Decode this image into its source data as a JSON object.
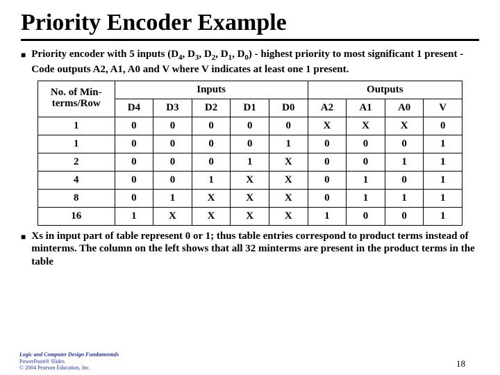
{
  "title": "Priority Encoder Example",
  "bullets": {
    "b1_pre": "Priority encoder with 5 inputs (D",
    "b1_mid1": ", D",
    "b1_mid2": ", D",
    "b1_mid3": ", D",
    "b1_mid4": ", D",
    "b1_post": ") - highest priority to most significant 1 present - Code outputs A2, A1, A0 and V where V indicates at least one 1 present.",
    "b1_s4": "4",
    "b1_s3": "3",
    "b1_s2": "2",
    "b1_s1": "1",
    "b1_s0": "0",
    "b2": "Xs in input part of table represent 0 or 1; thus table entries correspond to product terms instead of minterms. The column on the left shows that all 32 minterms are present in the product terms in the table"
  },
  "table": {
    "hdr_left_l1": "No. of Min-",
    "hdr_left_l2": "terms/Row",
    "hdr_inputs": "Inputs",
    "hdr_outputs": "Outputs",
    "cols": [
      "D4",
      "D3",
      "D2",
      "D1",
      "D0",
      "A2",
      "A1",
      "A0",
      "V"
    ],
    "rows": [
      [
        "1",
        "0",
        "0",
        "0",
        "0",
        "0",
        "X",
        "X",
        "X",
        "0"
      ],
      [
        "1",
        "0",
        "0",
        "0",
        "0",
        "1",
        "0",
        "0",
        "0",
        "1"
      ],
      [
        "2",
        "0",
        "0",
        "0",
        "1",
        "X",
        "0",
        "0",
        "1",
        "1"
      ],
      [
        "4",
        "0",
        "0",
        "1",
        "X",
        "X",
        "0",
        "1",
        "0",
        "1"
      ],
      [
        "8",
        "0",
        "1",
        "X",
        "X",
        "X",
        "0",
        "1",
        "1",
        "1"
      ],
      [
        "16",
        "1",
        "X",
        "X",
        "X",
        "X",
        "1",
        "0",
        "0",
        "1"
      ]
    ]
  },
  "footer": {
    "l1": "Logic and Computer Design Fundamentals",
    "l2": "PowerPoint® Slides",
    "l3": "© 2004 Pearson Education, Inc."
  },
  "page": "18"
}
